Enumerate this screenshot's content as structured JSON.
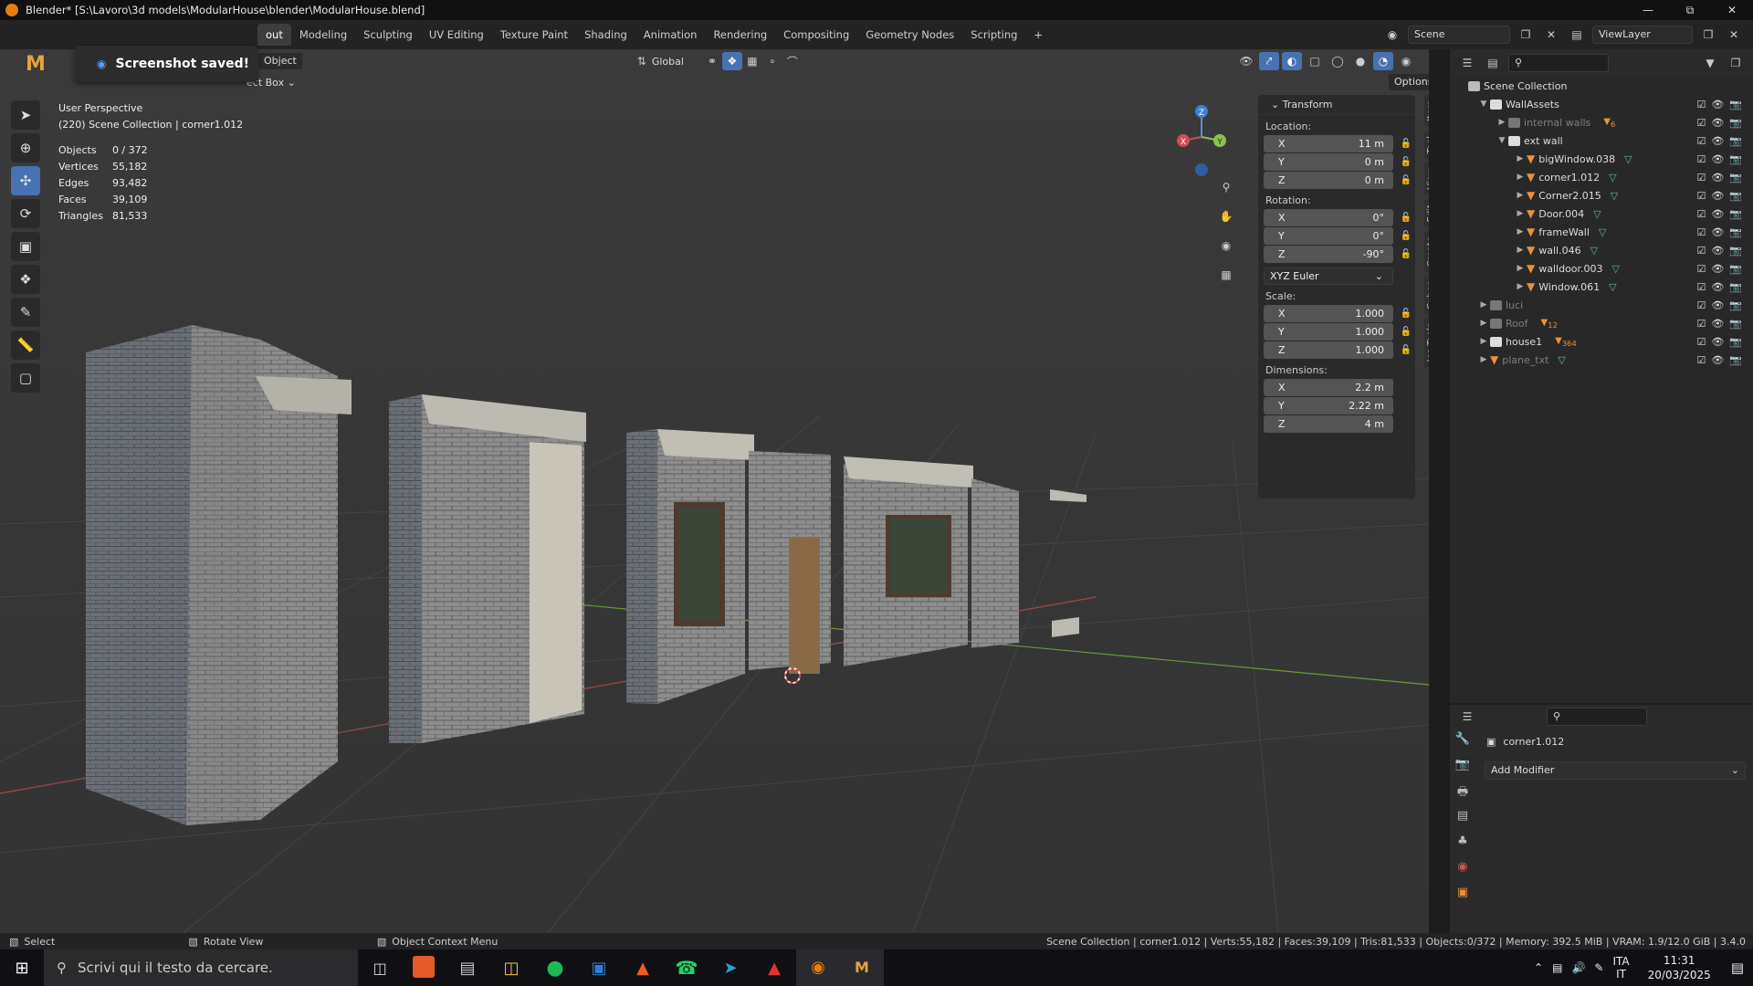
{
  "window": {
    "title": "Blender* [S:\\Lavoro\\3d models\\ModularHouse\\blender\\ModularHouse.blend]"
  },
  "menu": {
    "workspaces": [
      "out",
      "Modeling",
      "Sculpting",
      "UV Editing",
      "Texture Paint",
      "Shading",
      "Animation",
      "Rendering",
      "Compositing",
      "Geometry Nodes",
      "Scripting"
    ],
    "add_workspace": "+",
    "scene": "Scene",
    "view_layer": "ViewLayer"
  },
  "toast": {
    "message": "Screenshot saved!"
  },
  "viewport": {
    "mode": "Object",
    "orientation": "Global",
    "select_mode": "ect Box",
    "options": "Options",
    "perspective": "User Perspective",
    "collection_info": "(220) Scene Collection | corner1.012"
  },
  "stats": [
    {
      "label": "Objects",
      "value": "0 / 372"
    },
    {
      "label": "Vertices",
      "value": "55,182"
    },
    {
      "label": "Edges",
      "value": "93,482"
    },
    {
      "label": "Faces",
      "value": "39,109"
    },
    {
      "label": "Triangles",
      "value": "81,533"
    }
  ],
  "gizmo": {
    "x": "X",
    "y": "Y",
    "z": "Z"
  },
  "transform": {
    "header": "Transform",
    "location_label": "Location:",
    "location": [
      {
        "axis": "X",
        "value": "11 m"
      },
      {
        "axis": "Y",
        "value": "0 m"
      },
      {
        "axis": "Z",
        "value": "0 m"
      }
    ],
    "rotation_label": "Rotation:",
    "rotation": [
      {
        "axis": "X",
        "value": "0°"
      },
      {
        "axis": "Y",
        "value": "0°"
      },
      {
        "axis": "Z",
        "value": "-90°"
      }
    ],
    "rotation_mode": "XYZ Euler",
    "scale_label": "Scale:",
    "scale": [
      {
        "axis": "X",
        "value": "1.000"
      },
      {
        "axis": "Y",
        "value": "1.000"
      },
      {
        "axis": "Z",
        "value": "1.000"
      }
    ],
    "dimensions_label": "Dimensions:",
    "dimensions": [
      {
        "axis": "X",
        "value": "2.2 m"
      },
      {
        "axis": "Y",
        "value": "2.22 m"
      },
      {
        "axis": "Z",
        "value": "4 m"
      }
    ]
  },
  "side_tabs": [
    "Item",
    "Tool",
    "View",
    "Edit",
    "Create",
    "Cuber",
    "Ice Tools"
  ],
  "outliner": {
    "root": "Scene Collection",
    "rows": [
      {
        "name": "WallAssets",
        "indent": 1,
        "type": "collection",
        "expanded": true,
        "dim": false
      },
      {
        "name": "internal walls",
        "indent": 2,
        "type": "collection",
        "expanded": false,
        "dim": true,
        "badge": "6"
      },
      {
        "name": "ext wall",
        "indent": 2,
        "type": "collection",
        "expanded": true,
        "dim": false
      },
      {
        "name": "bigWindow.038",
        "indent": 3,
        "type": "mesh",
        "dim": false
      },
      {
        "name": "corner1.012",
        "indent": 3,
        "type": "mesh",
        "dim": false
      },
      {
        "name": "Corner2.015",
        "indent": 3,
        "type": "mesh",
        "dim": false
      },
      {
        "name": "Door.004",
        "indent": 3,
        "type": "mesh",
        "dim": false
      },
      {
        "name": "frameWall",
        "indent": 3,
        "type": "mesh",
        "dim": false
      },
      {
        "name": "wall.046",
        "indent": 3,
        "type": "mesh",
        "dim": false
      },
      {
        "name": "walldoor.003",
        "indent": 3,
        "type": "mesh",
        "dim": false
      },
      {
        "name": "Window.061",
        "indent": 3,
        "type": "mesh",
        "dim": false
      },
      {
        "name": "luci",
        "indent": 1,
        "type": "collection",
        "expanded": false,
        "dim": true
      },
      {
        "name": "Roof",
        "indent": 1,
        "type": "collection",
        "expanded": false,
        "dim": true,
        "badge": "12"
      },
      {
        "name": "house1",
        "indent": 1,
        "type": "collection",
        "expanded": false,
        "dim": false,
        "badge": "364"
      },
      {
        "name": "plane_txt",
        "indent": 1,
        "type": "mesh",
        "expanded": false,
        "dim": true
      }
    ]
  },
  "properties": {
    "object_name": "corner1.012",
    "add_modifier": "Add Modifier"
  },
  "statusbar": {
    "left": "Select",
    "middle": "Rotate View",
    "context": "Object Context Menu",
    "right": "Scene Collection | corner1.012 | Verts:55,182 | Faces:39,109 | Tris:81,533 | Objects:0/372 | Memory: 392.5 MiB | VRAM: 1.9/12.0 GiB | 3.4.0"
  },
  "taskbar": {
    "search_placeholder": "Scrivi qui il testo da cercare.",
    "lang_top": "ITA",
    "lang_bottom": "IT",
    "time": "11:31",
    "date": "20/03/2025"
  }
}
